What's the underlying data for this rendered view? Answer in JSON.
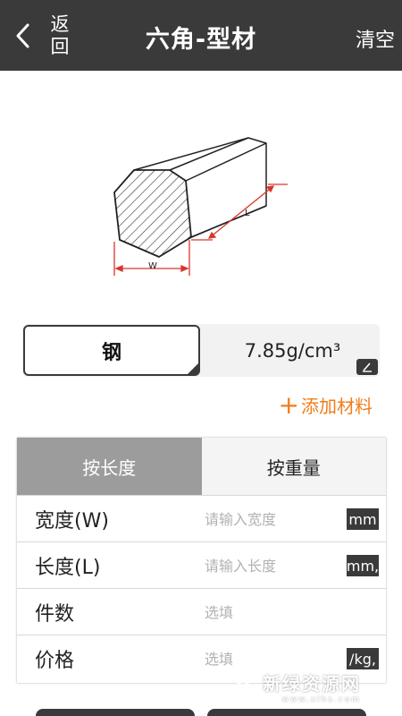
{
  "header": {
    "back_label": "返回",
    "title": "六角-型材",
    "clear_label": "清空"
  },
  "diagram": {
    "width_label": "W",
    "length_label": "L",
    "dimension_color": "#d9362b"
  },
  "material": {
    "name": "钢",
    "density": "7.85g/cm³",
    "add_label": "添加材料",
    "add_color": "#f07d1a"
  },
  "tabs": [
    {
      "label": "按长度",
      "active": true
    },
    {
      "label": "按重量",
      "active": false
    }
  ],
  "fields": [
    {
      "label": "宽度(W)",
      "placeholder": "请输入宽度",
      "unit": "mm"
    },
    {
      "label": "长度(L)",
      "placeholder": "请输入长度",
      "unit": "mm,"
    },
    {
      "label": "件数",
      "placeholder": "选填",
      "unit": ""
    },
    {
      "label": "价格",
      "placeholder": "选填",
      "unit": "/kg,"
    }
  ],
  "watermark": {
    "text": "新绿资源网",
    "url_text": "www.xlhs.com"
  },
  "colors": {
    "header_bg": "#3a3a3a",
    "accent": "#f07d1a",
    "active_tab": "#9c9c9c"
  }
}
